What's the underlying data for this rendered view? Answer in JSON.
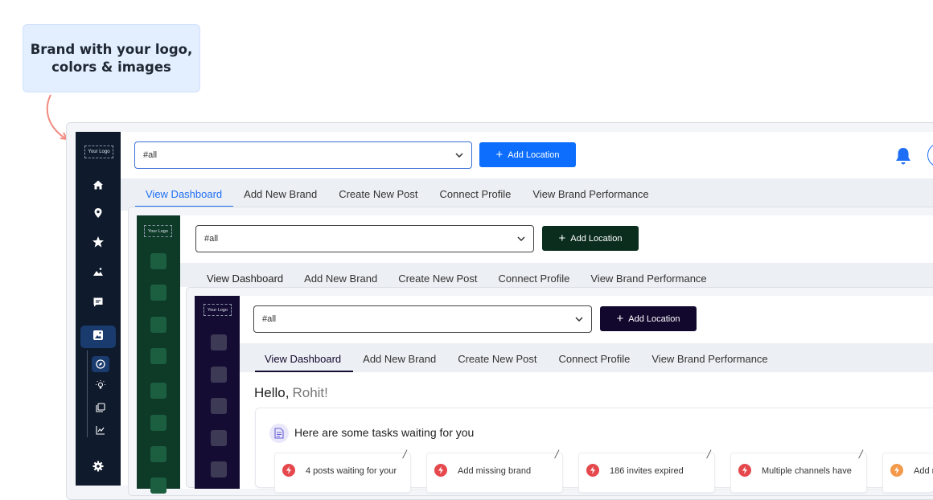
{
  "callout": {
    "text": "Brand with your logo, colors & images"
  },
  "logo_text": "Your Logo",
  "colors": {
    "level1_sidebar": "#0f1a2c",
    "level1_button": "#0d6efd",
    "level2_sidebar": "#0e3a28",
    "level2_button": "#0b2d1e",
    "level3_sidebar": "#150c33",
    "level3_button": "#12082e",
    "alert_red": "#e5484d",
    "alert_orange": "#f2994a"
  },
  "level1": {
    "select_value": "#all",
    "add_location": "Add Location",
    "tabs": [
      "View Dashboard",
      "Add New Brand",
      "Create New Post",
      "Connect Profile",
      "View Brand Performance"
    ],
    "active_tab": "View Dashboard",
    "sidebar_icons": [
      "home-icon",
      "location-pin-icon",
      "star-icon",
      "image-landscape-icon",
      "chat-icon",
      "gallery-icon",
      "compass-icon",
      "bulb-icon",
      "copy-icon",
      "chart-icon",
      "gear-icon"
    ]
  },
  "level2": {
    "select_value": "#all",
    "add_location": "Add Location",
    "tabs": [
      "View Dashboard",
      "Add New Brand",
      "Create New Post",
      "Connect Profile",
      "View Brand Performance"
    ]
  },
  "level3": {
    "select_value": "#all",
    "add_location": "Add Location",
    "tabs": [
      "View Dashboard",
      "Add New Brand",
      "Create New Post",
      "Connect Profile",
      "View Brand Performance"
    ],
    "greeting": "Hello,",
    "user_name": "Rohit!",
    "tasks_title": "Here are some tasks waiting for you",
    "tasks": [
      {
        "text": "4 posts waiting for your",
        "color": "#e5484d"
      },
      {
        "text": "Add missing brand",
        "color": "#e5484d"
      },
      {
        "text": "186 invites expired",
        "color": "#e5484d"
      },
      {
        "text": "Multiple channels have",
        "color": "#e5484d"
      },
      {
        "text": "Add n",
        "color": "#f2994a"
      }
    ]
  }
}
